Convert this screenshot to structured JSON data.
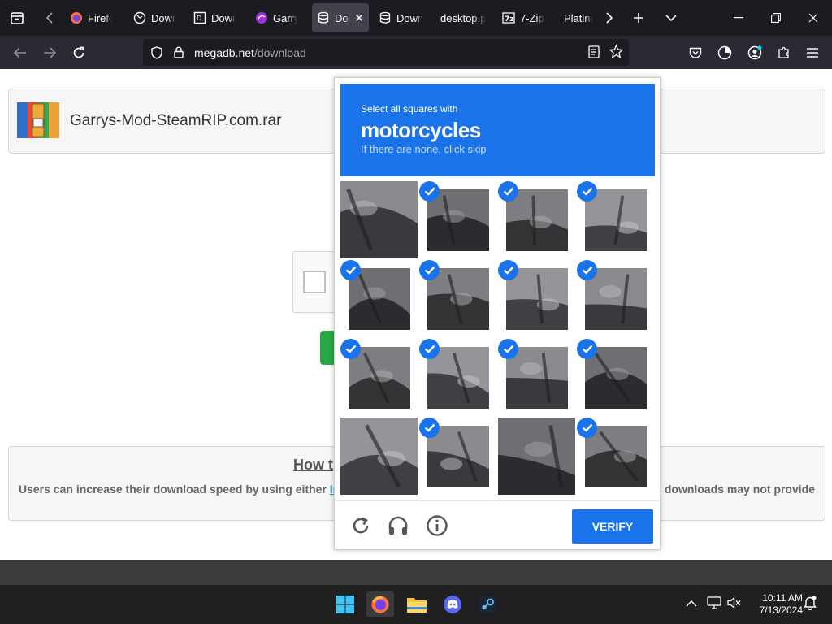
{
  "browser": {
    "tabs": [
      {
        "label": "Firefox",
        "icon": "firefox-icon"
      },
      {
        "label": "Download",
        "icon": "globe-icon"
      },
      {
        "label": "Download",
        "icon": "download-icon"
      },
      {
        "label": "Garry's Mod",
        "icon": "garrysmod-icon"
      },
      {
        "label": "Download",
        "icon": "database-icon",
        "active": true
      },
      {
        "label": "Download",
        "icon": "database-icon"
      },
      {
        "label": "desktop.pi"
      },
      {
        "label": "7-Zip",
        "icon": "sevenzip-icon"
      },
      {
        "label": "Platinum"
      }
    ],
    "url_host": "megadb.net",
    "url_path": "/download"
  },
  "page": {
    "file_name": "Garrys-Mod-SteamRIP.com.rar",
    "howto_title": "How t",
    "howto_text_left": "Users can increase their download speed by using either ",
    "howto_link": "Int",
    "howto_text_right": "s downloads may not provide"
  },
  "captcha": {
    "instruction": "Select all squares with",
    "target": "motorcycles",
    "hint": "If there are none, click skip",
    "verify_label": "VERIFY",
    "tiles": [
      {
        "selected": false
      },
      {
        "selected": true
      },
      {
        "selected": true
      },
      {
        "selected": true
      },
      {
        "selected": true
      },
      {
        "selected": true
      },
      {
        "selected": true
      },
      {
        "selected": true
      },
      {
        "selected": true
      },
      {
        "selected": true
      },
      {
        "selected": true
      },
      {
        "selected": true
      },
      {
        "selected": false
      },
      {
        "selected": true
      },
      {
        "selected": false
      },
      {
        "selected": true
      }
    ]
  },
  "taskbar": {
    "time": "10:11 AM",
    "date": "7/13/2024",
    "apps": [
      "windows-start-icon",
      "firefox-icon",
      "file-explorer-icon",
      "discord-icon",
      "steam-icon"
    ]
  },
  "colors": {
    "captcha_blue": "#1a73e8",
    "browser_dark": "#1c1b22",
    "toolbar": "#2b2a33",
    "download_green": "#28a745"
  }
}
